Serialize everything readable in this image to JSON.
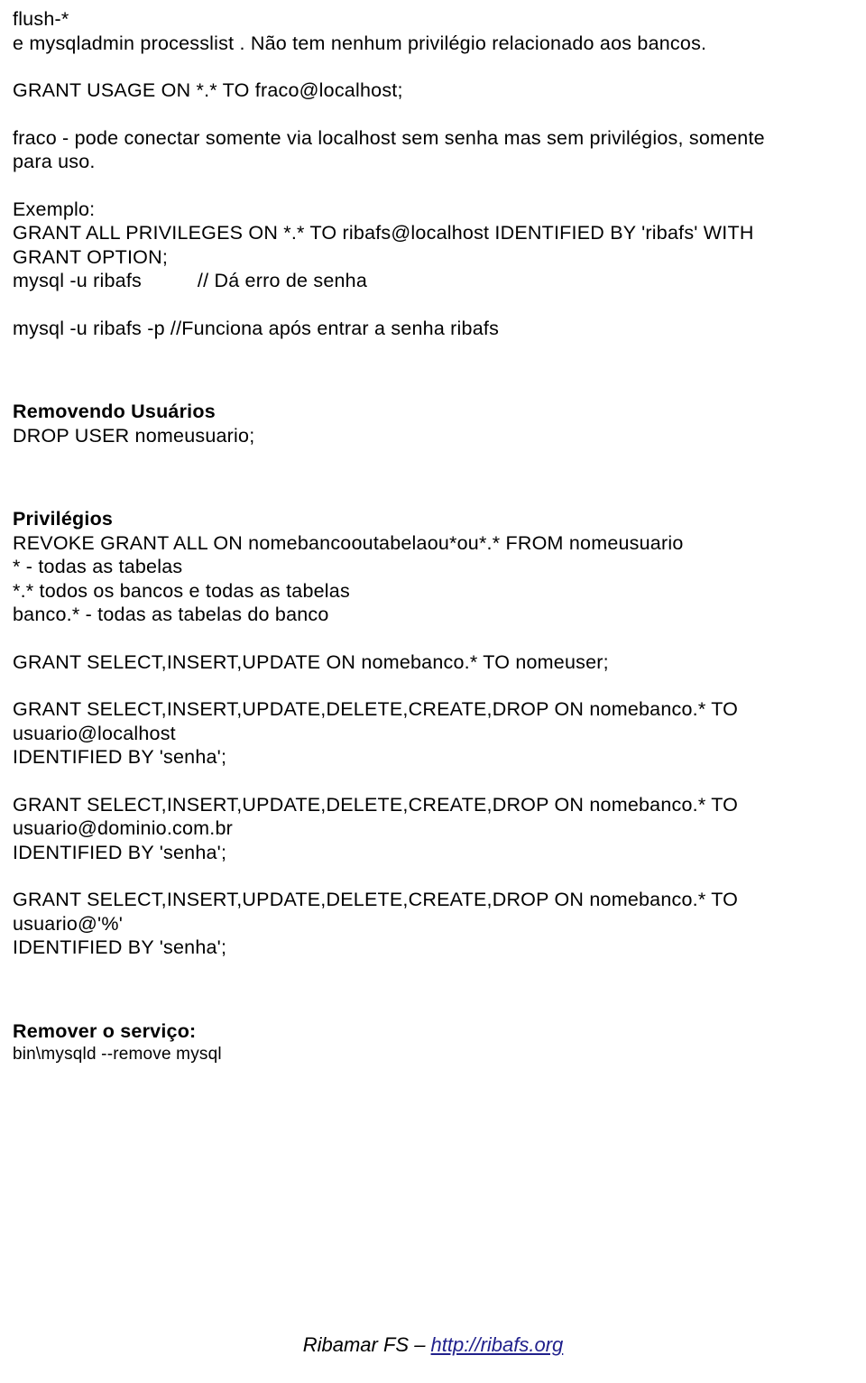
{
  "document": {
    "language": "pt-BR",
    "topic": "MySQL - Privilégios e Remoção de Usuários"
  },
  "body": {
    "blocks": [
      {
        "id": "intro",
        "lines": [
          "flush-*",
          "e mysqladmin processlist . Não tem nenhum privilégio relacionado aos bancos."
        ]
      },
      {
        "id": "grant-usage",
        "lines": [
          "GRANT USAGE ON *.* TO fraco@localhost;"
        ]
      },
      {
        "id": "fraco-explicacao",
        "lines": [
          "fraco - pode conectar somente via localhost sem senha mas sem privilégios, somente",
          "para uso."
        ]
      },
      {
        "id": "exemplo",
        "lines": [
          "Exemplo:",
          "GRANT ALL PRIVILEGES ON *.* TO ribafs@localhost IDENTIFIED BY 'ribafs' WITH",
          "GRANT OPTION;",
          "mysql -u ribafs          // Dá erro de senha"
        ]
      },
      {
        "id": "mysql-p",
        "lines": [
          "mysql -u ribafs -p //Funciona após entrar a senha ribafs"
        ]
      },
      {
        "id": "removendo-usuarios",
        "heading": "Removendo Usuários",
        "lines": [
          "DROP USER nomeusuario;"
        ]
      },
      {
        "id": "privilegios",
        "heading": "Privilégios",
        "lines": [
          "REVOKE GRANT ALL ON nomebancooutabelaou*ou*.* FROM nomeusuario",
          "* - todas as tabelas",
          "*.* todos os bancos e todas as tabelas",
          "banco.* - todas as tabelas do banco"
        ]
      },
      {
        "id": "grant-select-insert-update",
        "lines": [
          "GRANT SELECT,INSERT,UPDATE ON nomebanco.* TO nomeuser;"
        ]
      },
      {
        "id": "grant-localhost",
        "lines": [
          "GRANT SELECT,INSERT,UPDATE,DELETE,CREATE,DROP ON nomebanco.* TO",
          "usuario@localhost",
          "IDENTIFIED BY 'senha';"
        ]
      },
      {
        "id": "grant-dominio",
        "lines": [
          "GRANT SELECT,INSERT,UPDATE,DELETE,CREATE,DROP ON nomebanco.* TO",
          "usuario@dominio.com.br",
          "IDENTIFIED BY 'senha';"
        ]
      },
      {
        "id": "grant-wildcard",
        "lines": [
          "GRANT SELECT,INSERT,UPDATE,DELETE,CREATE,DROP ON nomebanco.* TO",
          "usuario@'%'",
          "IDENTIFIED BY 'senha';"
        ]
      },
      {
        "id": "remover-servico",
        "heading": "Remover o serviço:",
        "lines": [
          "bin\\mysqld --remove mysql"
        ]
      }
    ]
  },
  "footer": {
    "author": "Ribamar FS ",
    "separator": "– ",
    "link_text": "http://ribafs.org",
    "link_color": "#21218c"
  }
}
